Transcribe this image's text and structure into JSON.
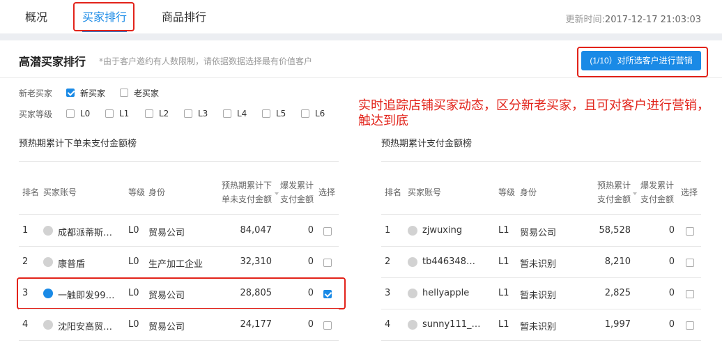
{
  "tabs": [
    {
      "label": "概况",
      "active": false
    },
    {
      "label": "买家排行",
      "active": true
    },
    {
      "label": "商品排行",
      "active": false
    }
  ],
  "update_time": {
    "label": "更新时间:",
    "value": "2017-12-17 21:03:03"
  },
  "section": {
    "title": "高潜买家排行",
    "note": "*由于客户邀约有人数限制，请依据数据选择最有价值客户",
    "marketing_button": "(1/10）对所选客户进行营销"
  },
  "filters": {
    "buyer_type": {
      "label": "新老买家",
      "options": [
        {
          "label": "新买家",
          "checked": true
        },
        {
          "label": "老买家",
          "checked": false
        }
      ]
    },
    "buyer_level": {
      "label": "买家等级",
      "options": [
        {
          "label": "L0",
          "checked": false
        },
        {
          "label": "L1",
          "checked": false
        },
        {
          "label": "L2",
          "checked": false
        },
        {
          "label": "L3",
          "checked": false
        },
        {
          "label": "L4",
          "checked": false
        },
        {
          "label": "L5",
          "checked": false
        },
        {
          "label": "L6",
          "checked": false
        }
      ]
    }
  },
  "annotation": "实时追踪店铺买家动态，区分新老买家，且可对客户进行营销，触达到底",
  "left_table": {
    "title": "预热期累计下单未支付金额榜",
    "headers": {
      "rank": "排名",
      "account": "买家账号",
      "level": "等级",
      "identity": "身份",
      "amount_1": "预热期累计下",
      "amount_2": "单未支付金额",
      "burst_1": "爆发累计",
      "burst_2": "支付金额",
      "select": "选择"
    },
    "rows": [
      {
        "rank": "1",
        "account": "成都派蒂斯…",
        "level": "L0",
        "identity": "贸易公司",
        "amount": "84,047",
        "burst": "0",
        "selected": false
      },
      {
        "rank": "2",
        "account": "康普盾",
        "level": "L0",
        "identity": "生产加工企业",
        "amount": "32,310",
        "burst": "0",
        "selected": false
      },
      {
        "rank": "3",
        "account": "一触即发99…",
        "level": "L0",
        "identity": "贸易公司",
        "amount": "28,805",
        "burst": "0",
        "selected": true
      },
      {
        "rank": "4",
        "account": "沈阳安高贸…",
        "level": "L0",
        "identity": "贸易公司",
        "amount": "24,177",
        "burst": "0",
        "selected": false
      }
    ]
  },
  "right_table": {
    "title": "预热期累计支付金额榜",
    "headers": {
      "rank": "排名",
      "account": "买家账号",
      "level": "等级",
      "identity": "身份",
      "amount_1": "预热累计",
      "amount_2": "支付金额",
      "burst_1": "爆发累计",
      "burst_2": "支付金额",
      "select": "选择"
    },
    "rows": [
      {
        "rank": "1",
        "account": "zjwuxing",
        "level": "L1",
        "identity": "贸易公司",
        "amount": "58,528",
        "burst": "0",
        "selected": false
      },
      {
        "rank": "2",
        "account": "tb446348…",
        "level": "L1",
        "identity": "暂未识别",
        "amount": "8,210",
        "burst": "0",
        "selected": false
      },
      {
        "rank": "3",
        "account": "hellyapple",
        "level": "L1",
        "identity": "暂未识别",
        "amount": "2,825",
        "burst": "0",
        "selected": false
      },
      {
        "rank": "4",
        "account": "sunny111_…",
        "level": "L1",
        "identity": "暂未识别",
        "amount": "1,997",
        "burst": "0",
        "selected": false
      }
    ]
  },
  "colors": {
    "accent": "#1a8ae6",
    "highlight": "#e2231a"
  }
}
